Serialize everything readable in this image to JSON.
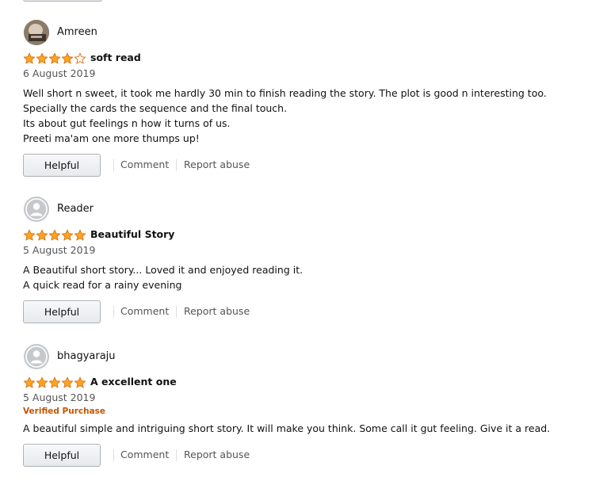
{
  "reviews": [
    {
      "name": "Amreen",
      "avatar": "profile-photo",
      "rating": 4,
      "title": "soft read",
      "date": "6 August 2019",
      "verified": "",
      "body": [
        "Well short n sweet, it took me hardly 30 min to finish reading the story. The plot is good n interesting too. Specially the cards the sequence and the final touch.",
        "Its about gut feelings n how it turns of us.",
        "Preeti ma'am one more thumps up!"
      ],
      "helpful_label": "Helpful",
      "comment_label": "Comment",
      "report_label": "Report abuse"
    },
    {
      "name": "Reader",
      "avatar": "default-user-icon",
      "rating": 5,
      "title": "Beautiful Story",
      "date": "5 August 2019",
      "verified": "",
      "body": [
        "A Beautiful short story... Loved it and enjoyed reading it.",
        "A quick read for a rainy evening"
      ],
      "helpful_label": "Helpful",
      "comment_label": "Comment",
      "report_label": "Report abuse"
    },
    {
      "name": "bhagyaraju",
      "avatar": "default-user-icon",
      "rating": 5,
      "title": "A excellent one",
      "date": "5 August 2019",
      "verified": "Verified Purchase",
      "body": [
        "A beautiful simple and intriguing short story. It will make you think. Some call it gut feeling. Give it a read."
      ],
      "helpful_label": "Helpful",
      "comment_label": "Comment",
      "report_label": "Report abuse"
    }
  ],
  "colors": {
    "star_fill": "#ffa41c",
    "star_stroke": "#de7921",
    "verified": "#c45500",
    "link_gray": "#555555"
  }
}
